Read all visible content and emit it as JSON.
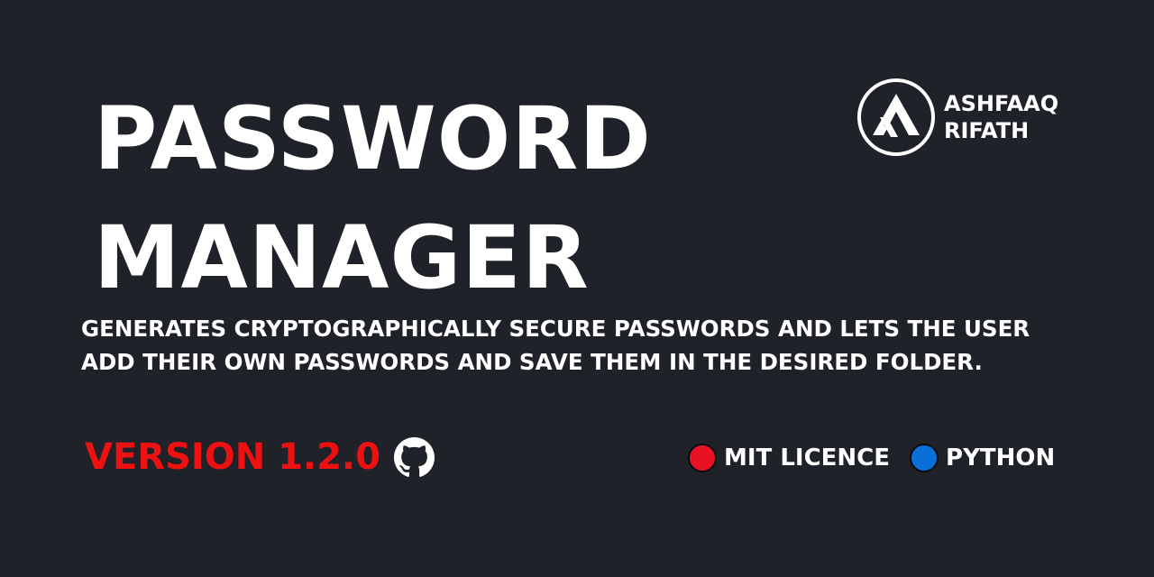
{
  "title": {
    "line1": "PASSWORD",
    "line2": "MANAGER"
  },
  "brand": {
    "logo_icon": "ar-monogram-logo",
    "name_line1": "ASHFAAQ",
    "name_line2": "RIFATH"
  },
  "description": "GENERATES CRYPTOGRAPHICALLY SECURE PASSWORDS AND LETS THE USER ADD THEIR OWN PASSWORDS AND SAVE THEM IN THE DESIRED FOLDER.",
  "version": {
    "label": "VERSION 1.2.0",
    "color": "#ee1111"
  },
  "github": {
    "icon": "github-icon"
  },
  "badges": [
    {
      "label": "MIT LICENCE",
      "color": "#e81224"
    },
    {
      "label": "PYTHON",
      "color": "#0a6fd6"
    }
  ],
  "colors": {
    "background": "#1f2229",
    "text": "#ffffff"
  }
}
